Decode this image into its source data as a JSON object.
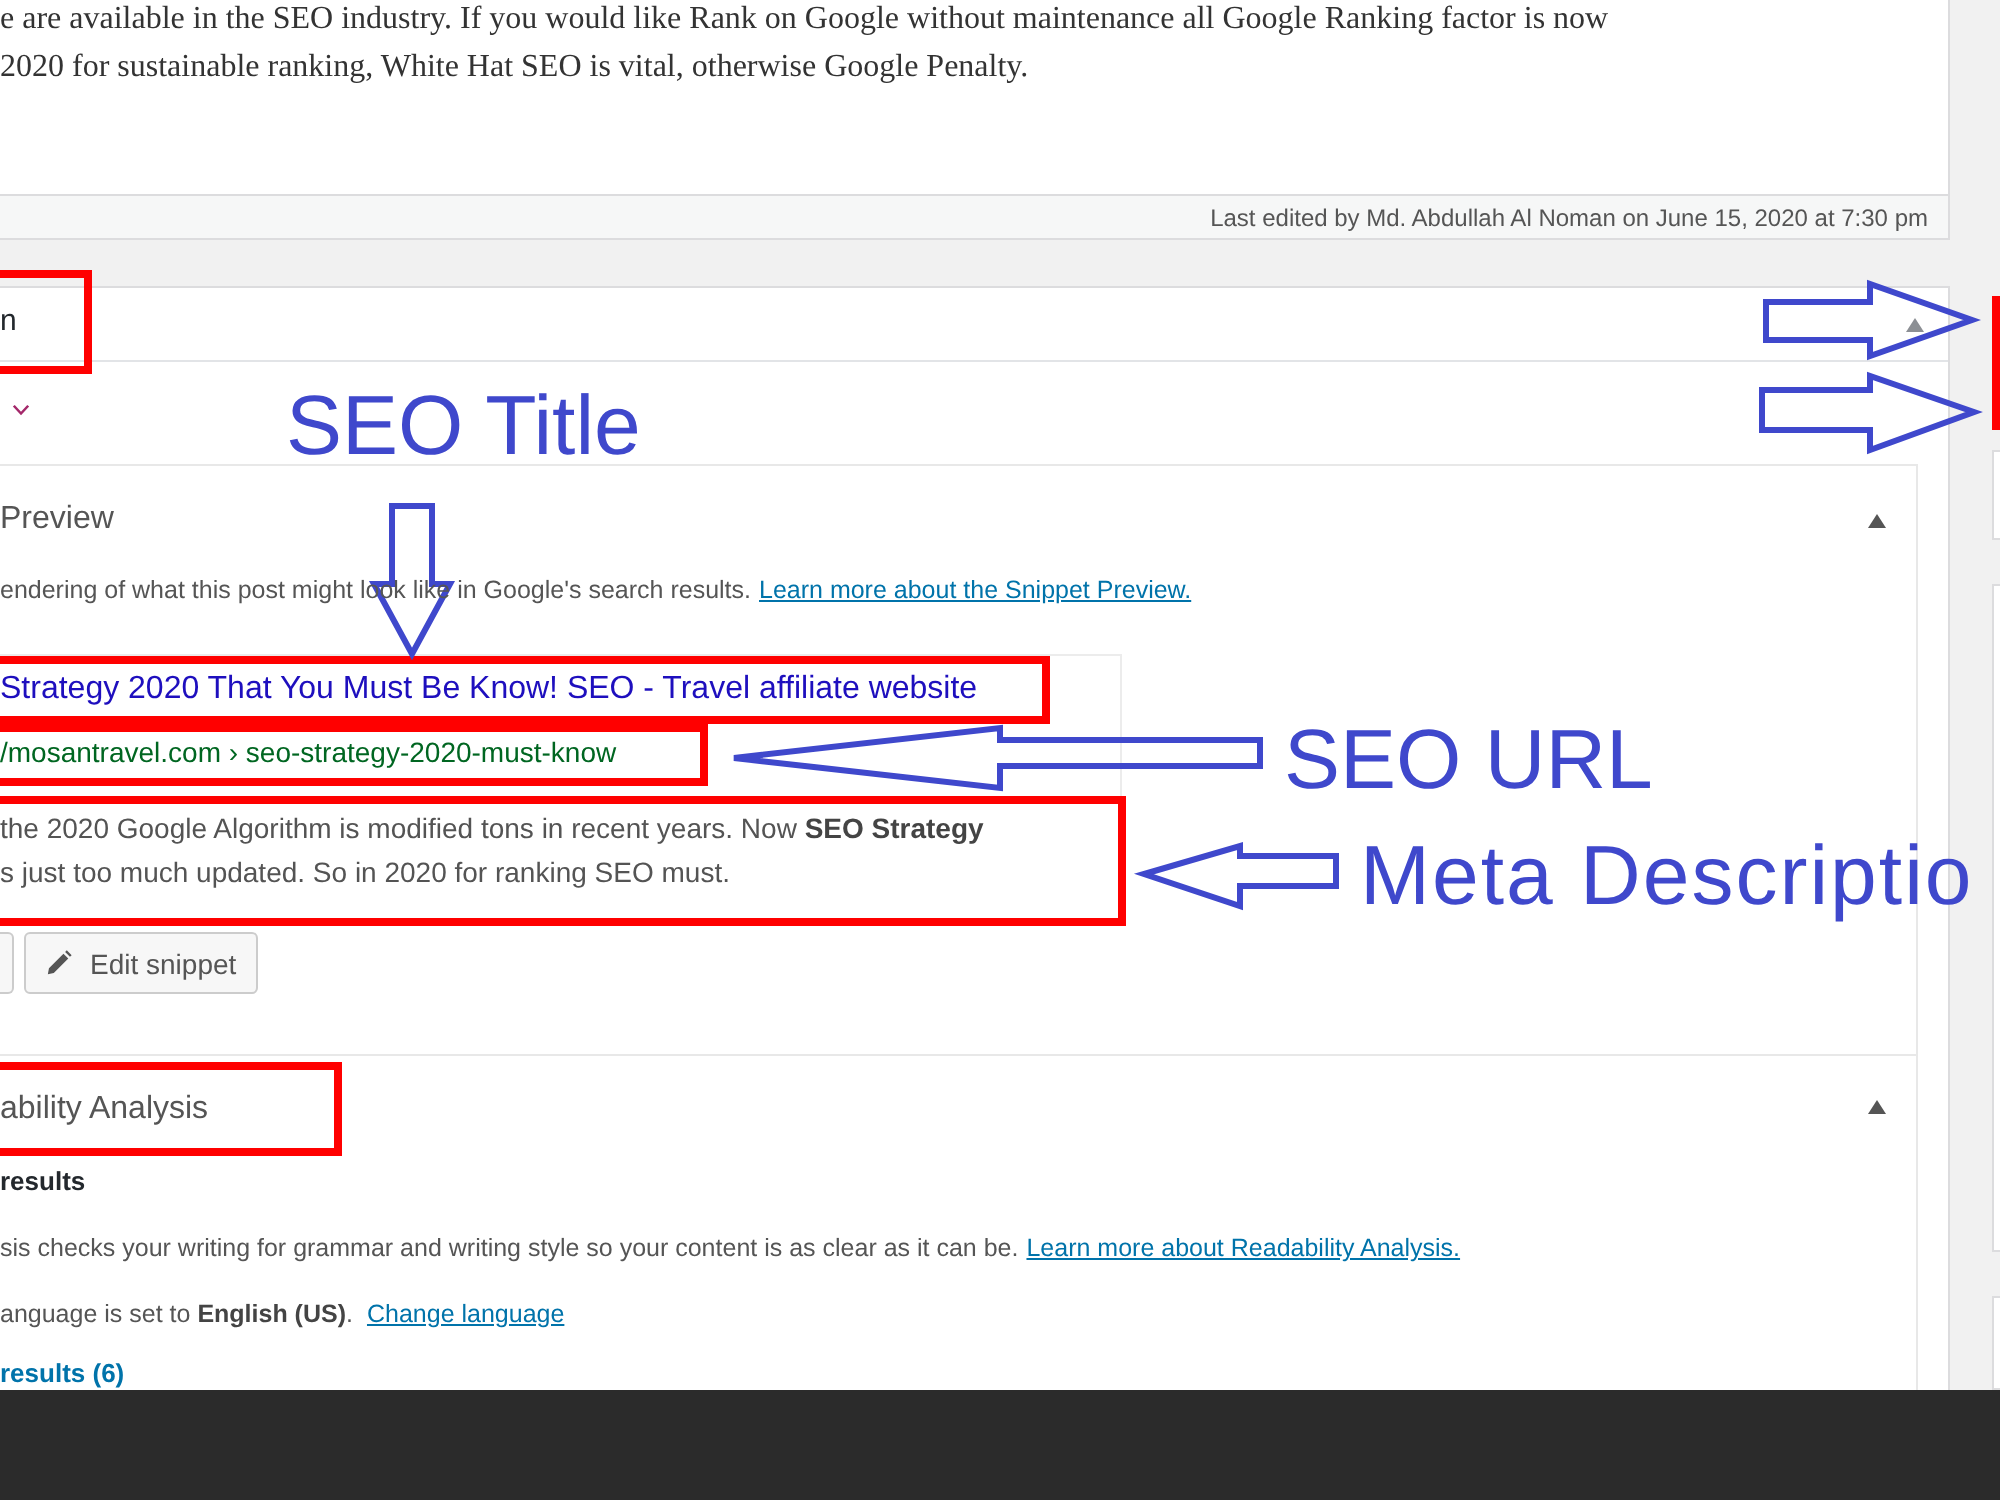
{
  "editor": {
    "lines": [
      "e are available in the SEO industry. If you would like Rank on Google without maintenance all Google Ranking factor is now",
      "2020 for sustainable ranking, White Hat SEO is vital, otherwise Google Penalty."
    ]
  },
  "status_bar": {
    "text": "Last edited by Md. Abdullah Al Noman on June 15, 2020 at 7:30 pm"
  },
  "metabox": {
    "title": "n",
    "highlighted": true,
    "expanded": true
  },
  "sections": [
    {
      "kind": "snippet",
      "title": "Preview",
      "highlighted": false,
      "expanded": true,
      "intro": "endering of what this post might look like in Google's search results.",
      "intro_link": "Learn more about the Snippet Preview.",
      "snippet": {
        "title": {
          "text": "Strategy 2020 That You Must Be Know! SEO - Travel affiliate website",
          "highlighted": true
        },
        "url": {
          "text": "/mosantravel.com › seo-strategy-2020-must-know",
          "highlighted": true
        },
        "description": {
          "lines": [
            "the 2020 Google Algorithm is modified tons in recent years. Now **SEO Strategy**",
            "s just too much updated. So in 2020 for ranking SEO must."
          ],
          "highlighted": true
        }
      },
      "buttons": [
        {
          "kind": "cut"
        },
        {
          "kind": "edit",
          "label": "Edit snippet"
        }
      ]
    },
    {
      "kind": "readability",
      "title": "ability Analysis",
      "highlighted": true,
      "expanded": true,
      "heading": "results",
      "intro": "sis checks your writing for grammar and writing style so your content is as clear as it can be.",
      "intro_link": "Learn more about Readability Analysis.",
      "language": "anguage is set to **English (US)**.",
      "language_link": "Change language",
      "results_link": "results (6)"
    }
  ],
  "annotations": [
    {
      "kind": "title",
      "text": "SEO Title"
    },
    {
      "kind": "url",
      "text": "SEO URL"
    },
    {
      "kind": "description",
      "text": "Meta Descriptio"
    }
  ]
}
